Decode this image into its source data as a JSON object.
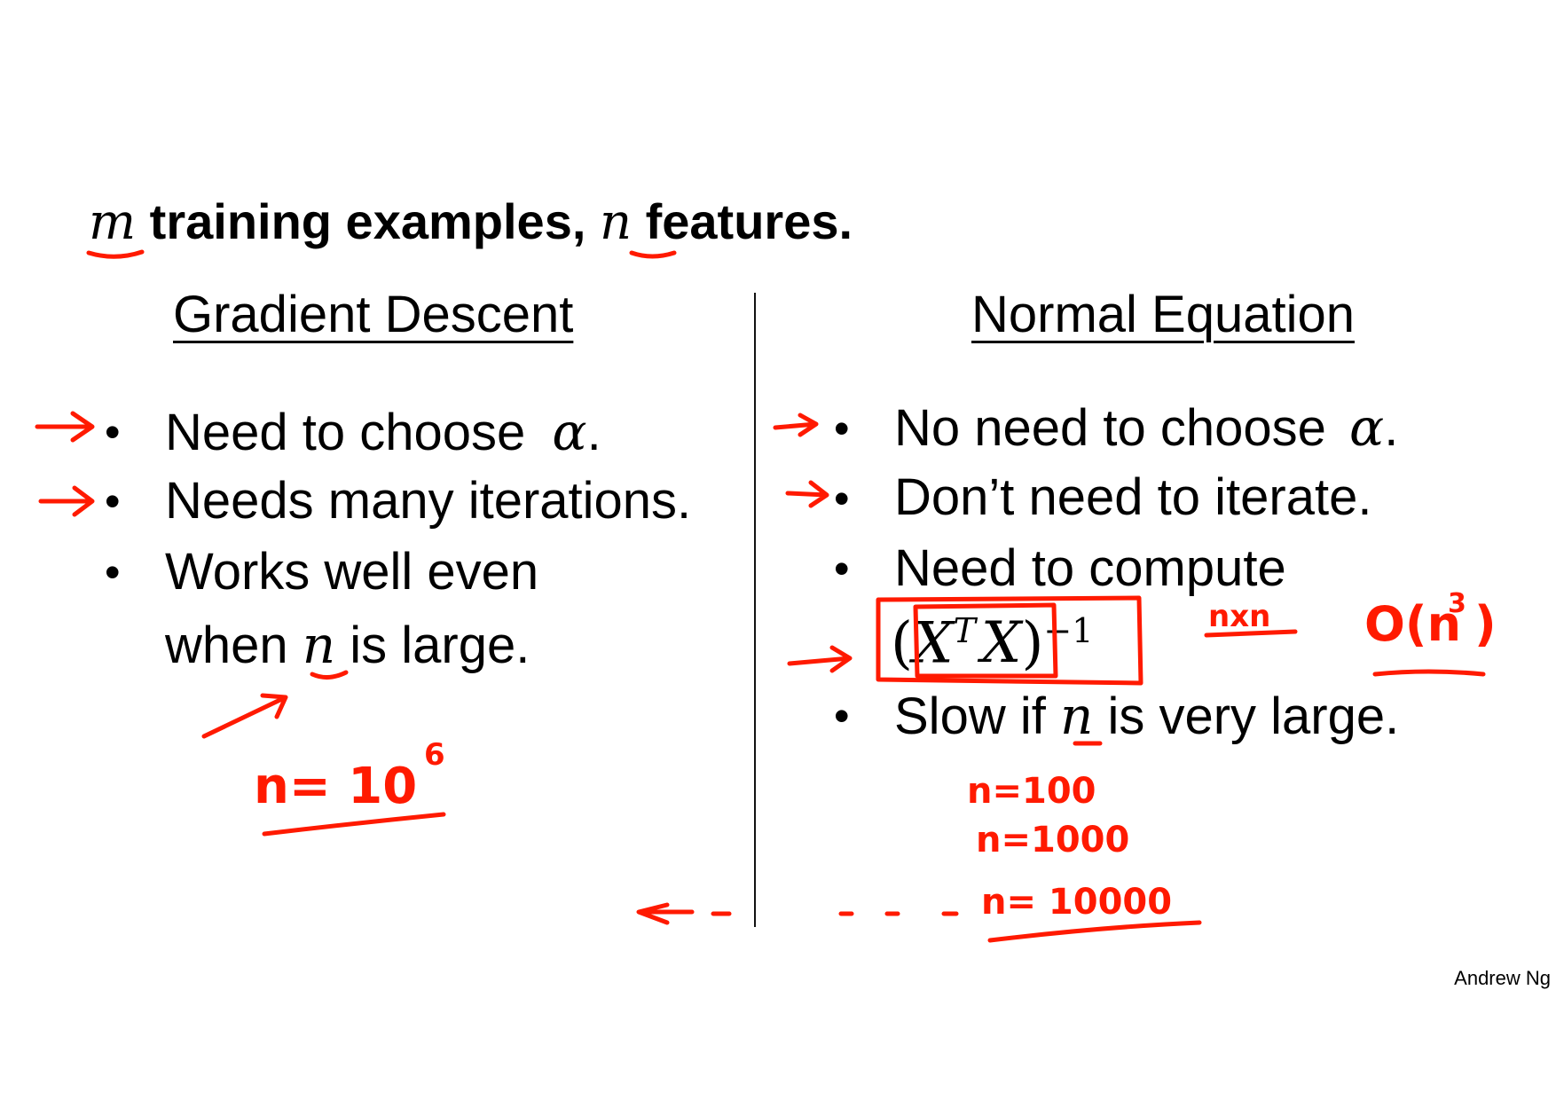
{
  "title": {
    "m_symbol": "m",
    "text_a": "training examples,",
    "n_symbol": "n",
    "text_b": "features."
  },
  "gradient_descent": {
    "heading": "Gradient Descent",
    "bullets": [
      {
        "text": "Need to choose",
        "symbol": "α",
        "suffix": "."
      },
      {
        "text": "Needs many iterations."
      },
      {
        "line1": "Works well even",
        "line2_a": "when",
        "symbol": "n",
        "line2_b": "is large."
      }
    ]
  },
  "normal_equation": {
    "heading": "Normal Equation",
    "bullets": [
      {
        "text": "No need to choose",
        "symbol": "α",
        "suffix": "."
      },
      {
        "text": "Don’t need to iterate."
      },
      {
        "line1": "Need to compute",
        "formula_open": "(",
        "formula_x": "X",
        "formula_t": "T",
        "formula_x2": "X",
        "formula_close": ")",
        "formula_exp": "−1"
      },
      {
        "text_a": "Slow if",
        "symbol": "n",
        "text_b": "is very large."
      }
    ]
  },
  "annotations": {
    "n_equals_10_6": "n= 10",
    "exp_6": "6",
    "n_x_n": "nxn",
    "big_o": "O(n",
    "big_o_exp": "3",
    "big_o_close": ")",
    "n100": "n=100",
    "n1000": "n=1000",
    "n10000": "n= 10000",
    "ink_color": "#ff1a00"
  },
  "author": "Andrew Ng"
}
